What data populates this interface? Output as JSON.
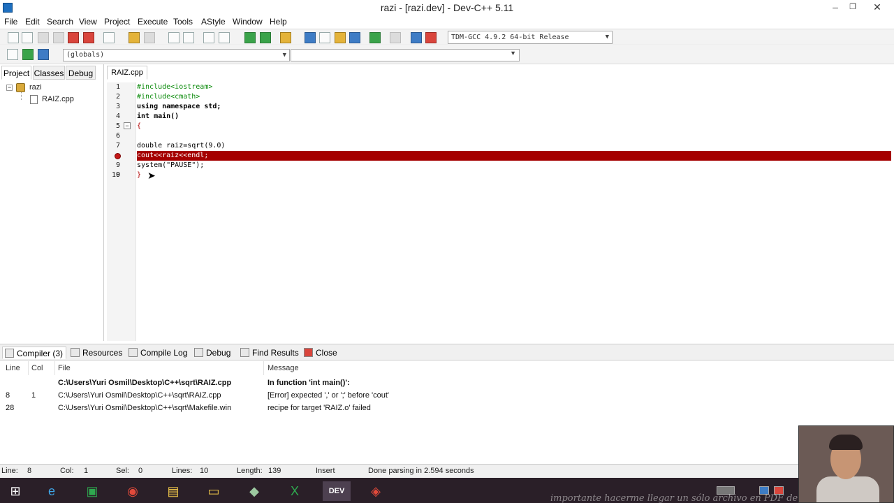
{
  "window": {
    "title": "razi - [razi.dev] - Dev-C++ 5.11",
    "min": "–",
    "max": "❐",
    "close": "✕"
  },
  "menu": [
    "File",
    "Edit",
    "Search",
    "View",
    "Project",
    "Execute",
    "Tools",
    "AStyle",
    "Window",
    "Help"
  ],
  "toolbar": {
    "compiler": "TDM-GCC 4.9.2 64-bit Release",
    "scope": "(globals)"
  },
  "left_tabs": [
    "Project",
    "Classes",
    "Debug"
  ],
  "tree": {
    "project": "razi",
    "file": "RAIZ.cpp"
  },
  "editor": {
    "tab": "RAIZ.cpp",
    "line_numbers": [
      "1",
      "2",
      "3",
      "4",
      "5",
      "6",
      "7",
      "8",
      "9",
      "10"
    ],
    "lines": [
      "#include<iostream>",
      "#include<cmath>",
      "using namespace std;",
      "int main()",
      "{",
      "",
      "double raiz=sqrt(9.0)",
      "cout<<raiz<<endl;",
      "system(\"PAUSE\");",
      "}"
    ],
    "error_line": 8,
    "colors": {
      "error_bg": "#a50000",
      "preprocessor": "#0a8a0a",
      "string": "#0000c0",
      "number": "#6a2fc0"
    }
  },
  "bottom_tabs": [
    "Compiler (3)",
    "Resources",
    "Compile Log",
    "Debug",
    "Find Results",
    "Close"
  ],
  "messages": {
    "headers": {
      "line": "Line",
      "col": "Col",
      "file": "File",
      "message": "Message"
    },
    "rows": [
      {
        "line": "",
        "col": "",
        "file": "C:\\Users\\Yuri Osmil\\Desktop\\C++\\sqrt\\RAIZ.cpp",
        "message": "In function 'int main()':"
      },
      {
        "line": "8",
        "col": "1",
        "file": "C:\\Users\\Yuri Osmil\\Desktop\\C++\\sqrt\\RAIZ.cpp",
        "message": "[Error] expected ',' or ';' before 'cout'"
      },
      {
        "line": "28",
        "col": "",
        "file": "C:\\Users\\Yuri Osmil\\Desktop\\C++\\sqrt\\Makefile.win",
        "message": "recipe for target 'RAIZ.o' failed"
      }
    ]
  },
  "status": {
    "line_label": "Line:",
    "line": "8",
    "col_label": "Col:",
    "col": "1",
    "sel_label": "Sel:",
    "sel": "0",
    "lines_label": "Lines:",
    "lines": "10",
    "length_label": "Length:",
    "length": "139",
    "mode": "Insert",
    "parse": "Done parsing in 2.594 seconds"
  },
  "taskbar": {
    "icons": [
      "windows-start-icon",
      "internet-explorer-icon",
      "store-icon",
      "chrome-icon",
      "file-explorer-icon",
      "folder-icon",
      "app-icon",
      "excel-icon",
      "devcpp-icon",
      "tool-icon"
    ]
  },
  "watermark": "importante hacerme llegar un sólo archivo en PDF de evidencia por"
}
